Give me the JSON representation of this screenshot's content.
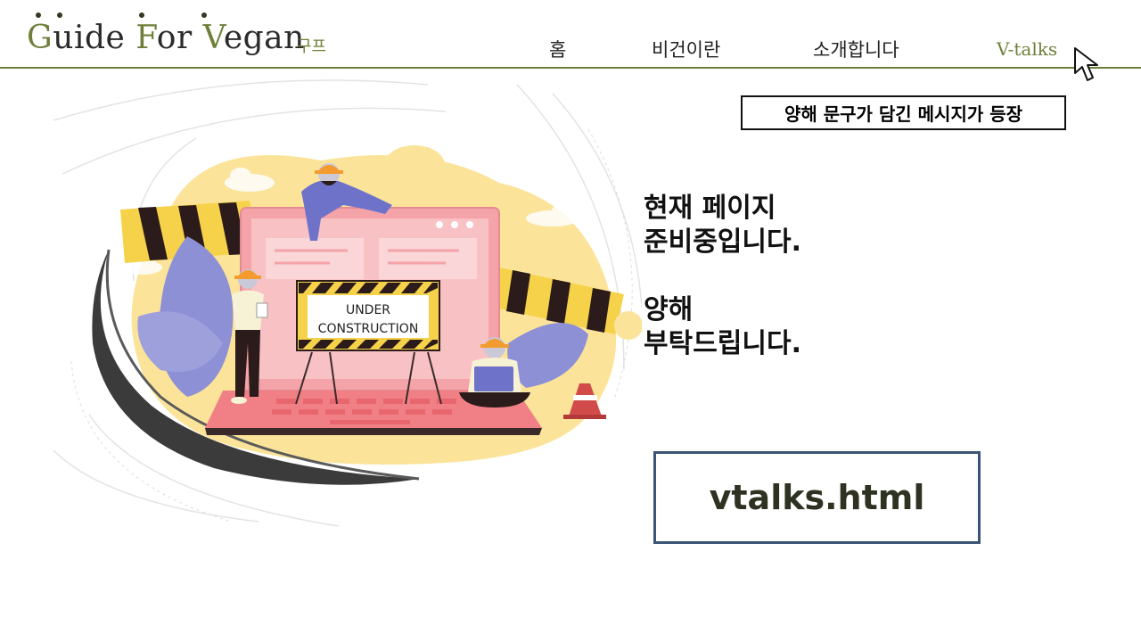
{
  "header": {
    "logo": {
      "g": "G",
      "uide": "uide ",
      "f": "F",
      "or": "or ",
      "v": "V",
      "egan": "egan"
    },
    "logo_sub": "구프",
    "nav": [
      {
        "label": "홈"
      },
      {
        "label": "비건이란"
      },
      {
        "label": "소개합니다"
      },
      {
        "label": "V-talks",
        "active": true
      }
    ]
  },
  "annotation": "양해 문구가 담긴 메시지가 등장",
  "illustration": {
    "sign_line1": "UNDER",
    "sign_line2": "CONSTRUCTION"
  },
  "message": {
    "line1": "현재 페이지",
    "line2": "준비중입니다.",
    "line3": "양해",
    "line4": "부탁드립니다."
  },
  "filename": "vtalks.html",
  "colors": {
    "accent": "#6e7f3a",
    "file_box_border": "#3b5375",
    "laptop": "#f4a3a8",
    "sun": "#fbe49a",
    "worker_blue": "#6f72c9"
  }
}
